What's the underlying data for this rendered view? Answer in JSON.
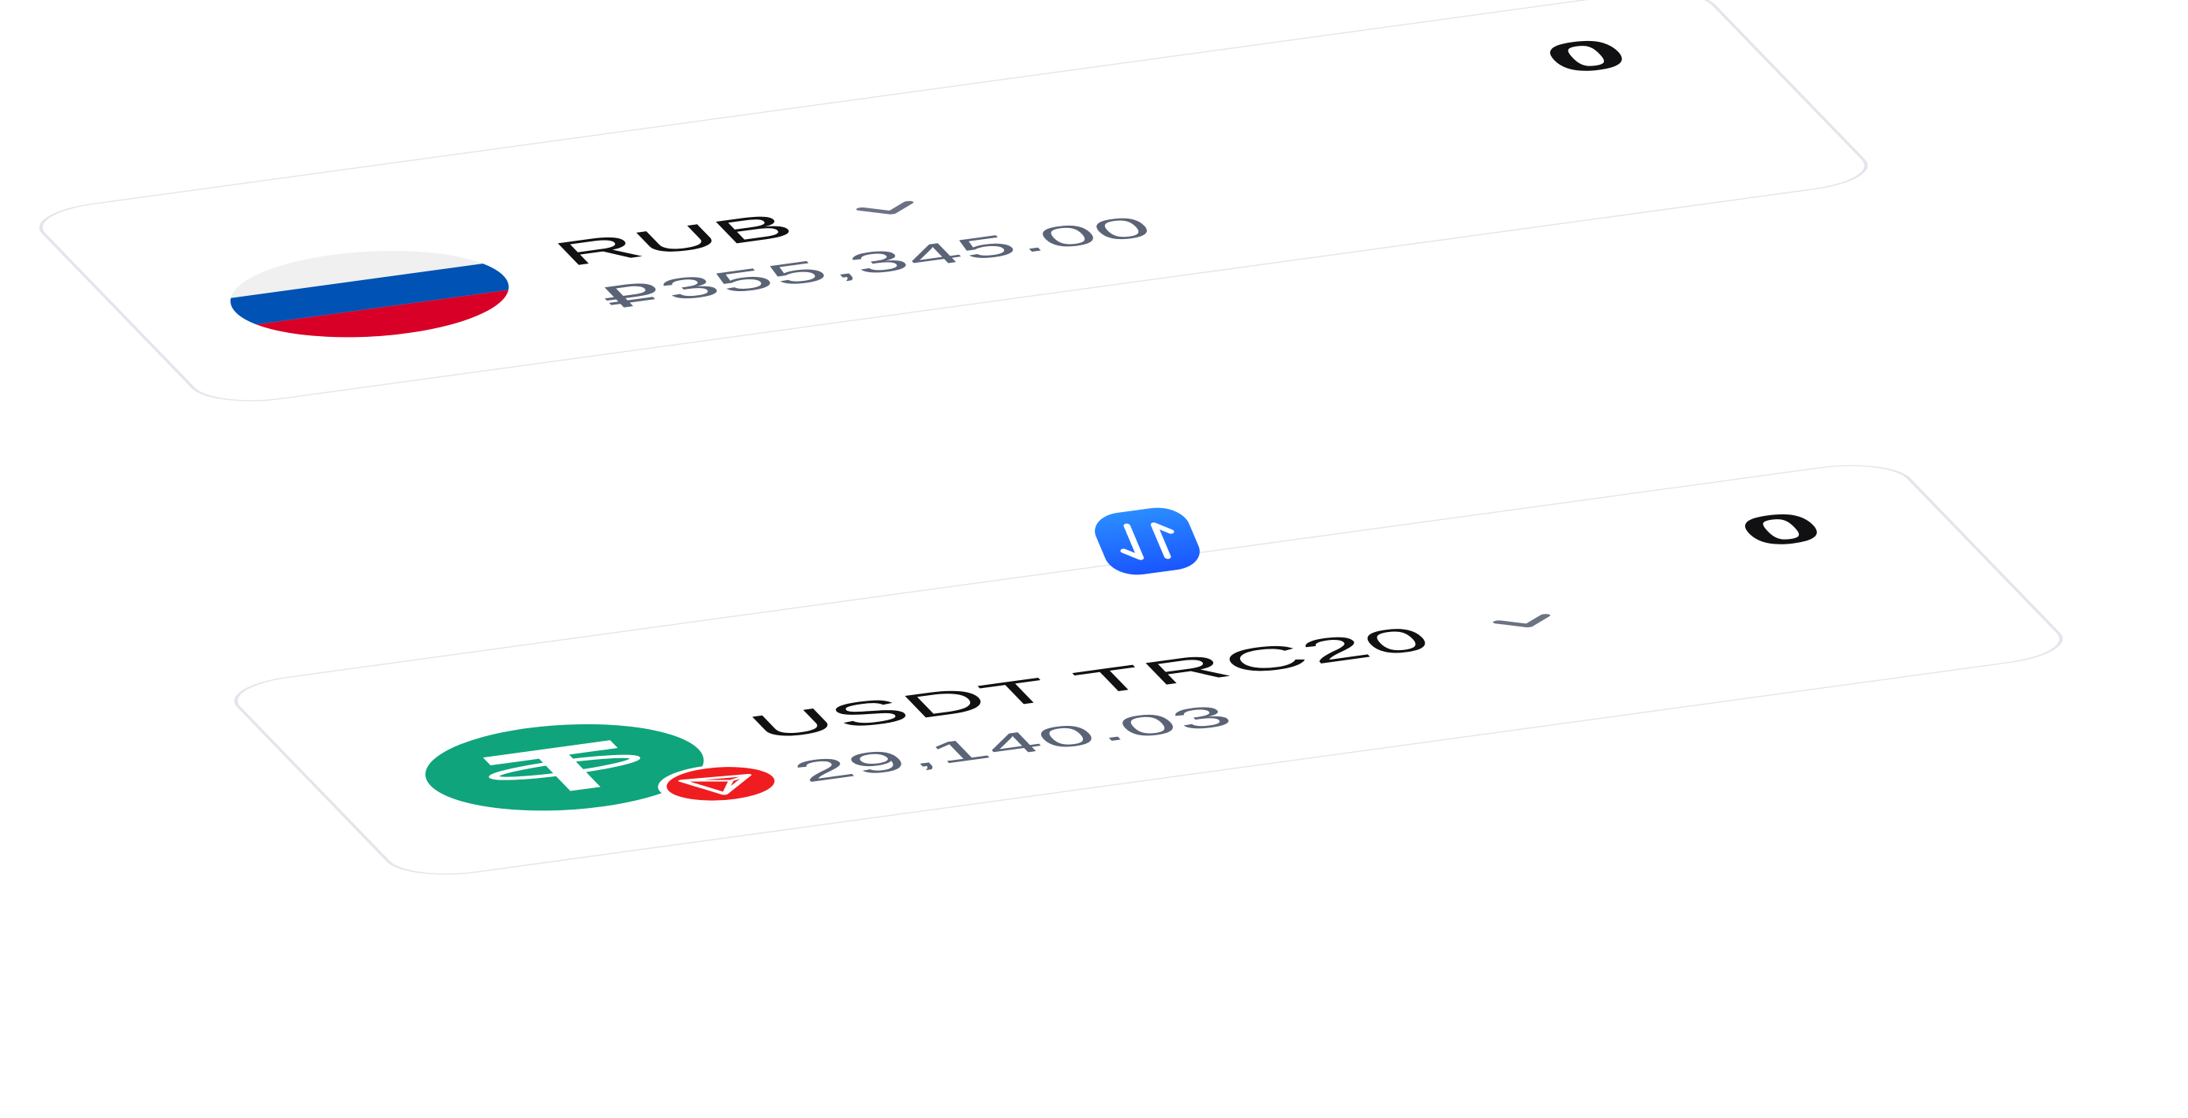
{
  "cards": [
    {
      "currency_code": "RUB",
      "balance": "₽355,345.00",
      "amount": "0",
      "icon": "russia-flag-icon",
      "flag_colors": [
        "#f0f0f0",
        "#0052b4",
        "#d80027"
      ]
    },
    {
      "currency_code": "USDT TRC20",
      "balance": "29,140.03",
      "amount": "0",
      "icon": "tether-icon",
      "badge_icon": "tron-icon",
      "colors": {
        "tether": "#0fa47c",
        "tron": "#ef1d20"
      }
    }
  ],
  "swap_button": {
    "icon": "swap-arrows-icon",
    "color": "#1f6bff"
  },
  "colors": {
    "card_border": "#e4e4ec",
    "code_text": "#111114",
    "balance_text": "#5b6477",
    "chevron": "#6b7283"
  }
}
